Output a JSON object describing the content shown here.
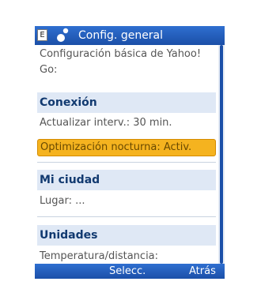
{
  "titlebar": {
    "input_mode": "E",
    "app_icon": "yahoo-go-icon",
    "title": "Config. general"
  },
  "intro": {
    "line1": "Configuración básica de Yahoo!",
    "line2": "Go:"
  },
  "sections": [
    {
      "heading": "Conexión",
      "items": [
        "Actualizar interv.: 30 min.",
        "Optimización nocturna: Activ."
      ]
    },
    {
      "heading": "Mi ciudad",
      "items": [
        "Lugar: ..."
      ]
    },
    {
      "heading": "Unidades",
      "items": [
        "Temperatura/distancia:"
      ]
    }
  ],
  "softkeys": {
    "left": "",
    "middle": "Selecc.",
    "right": "Atrás"
  },
  "colors": {
    "bar": "#1b4fa8",
    "section_bg": "#dfe8f5",
    "highlight": "#f5b31f"
  }
}
